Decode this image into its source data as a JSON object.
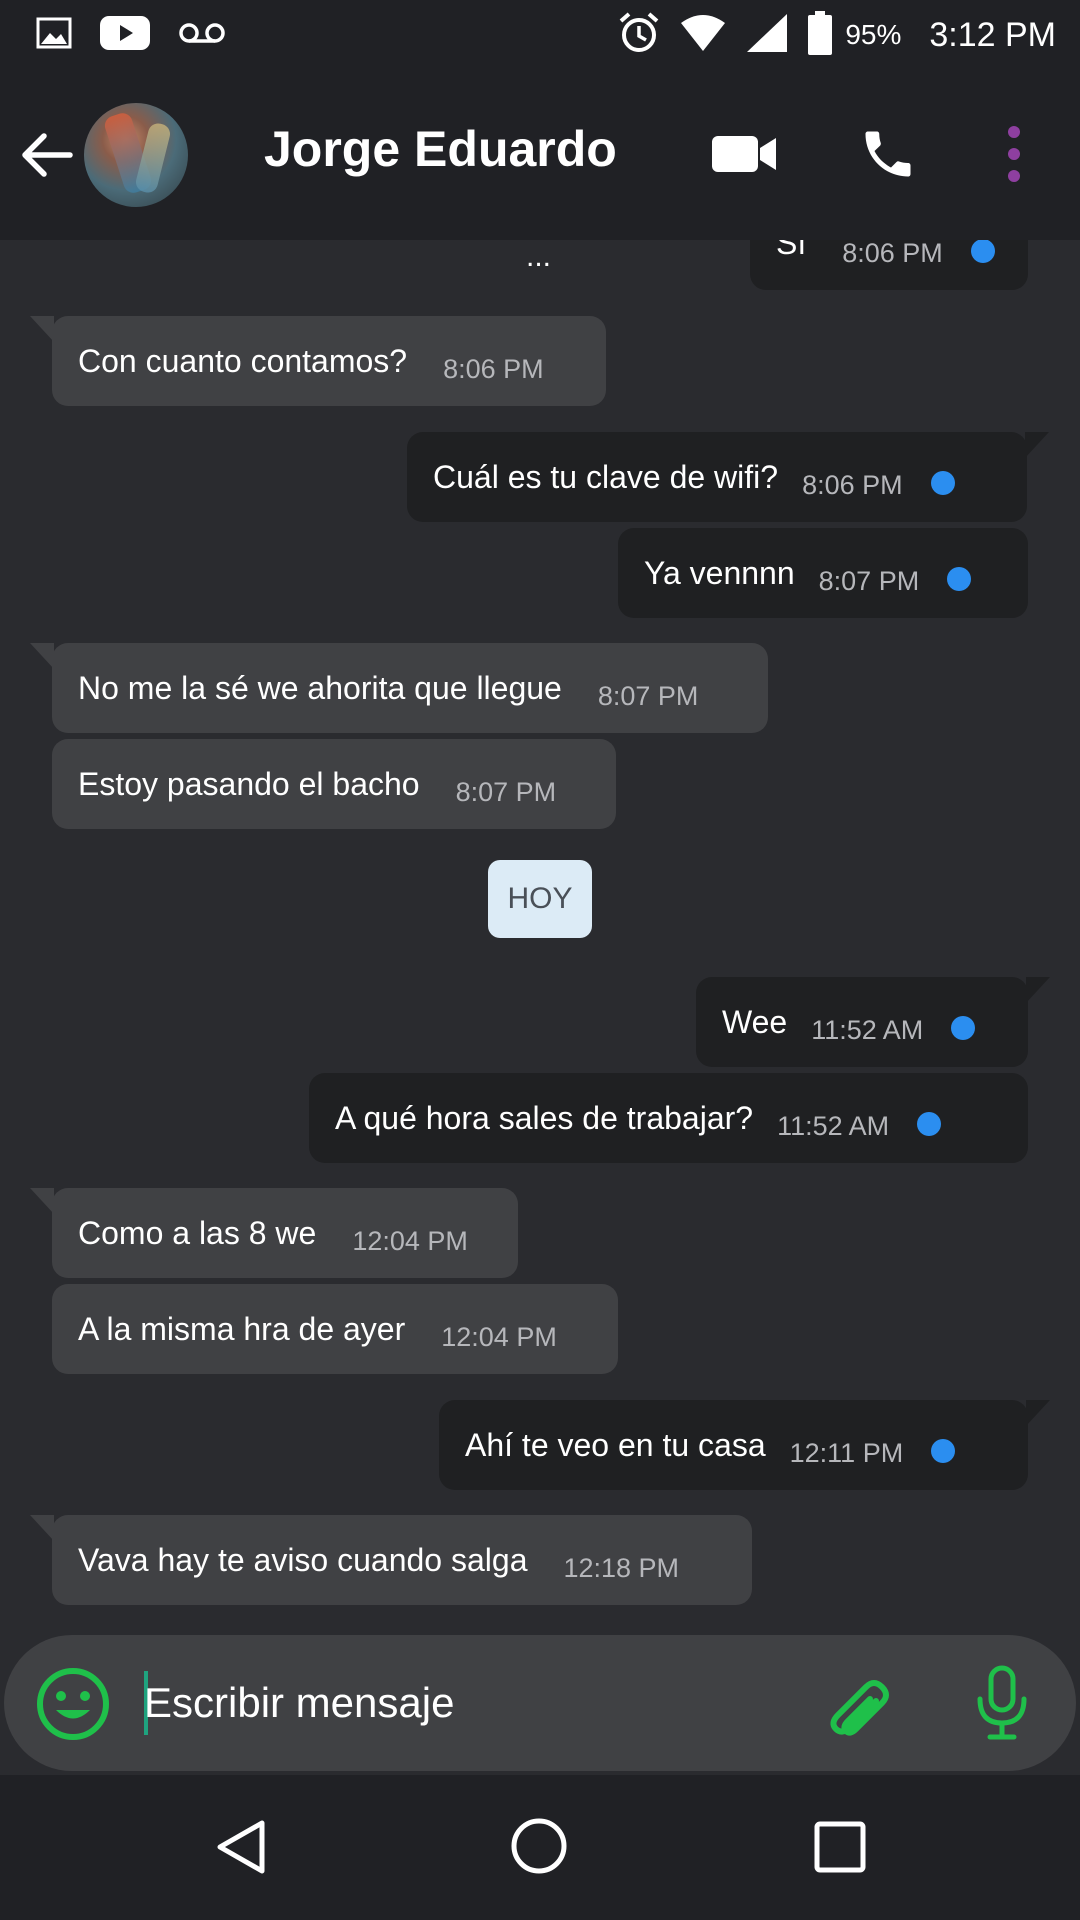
{
  "status_bar": {
    "battery": "95%",
    "time": "3:12 PM",
    "icons": [
      "image-icon",
      "youtube-icon",
      "voicemail-icon",
      "alarm-icon",
      "wifi-icon",
      "signal-icon",
      "battery-icon"
    ]
  },
  "header": {
    "contact_name": "Jorge Eduardo",
    "icons": [
      "back-arrow-icon",
      "avatar",
      "video-call-icon",
      "phone-icon",
      "more-vertical-icon"
    ],
    "accent_color": "#8e3fa0"
  },
  "chat": {
    "partial_top": {
      "text": "Sí",
      "time": "8:06 PM"
    },
    "typing_indicator": "...",
    "day_separator": "HOY",
    "messages": [
      {
        "direction": "in",
        "text": "Con cuanto contamos?",
        "time": "8:06 PM"
      },
      {
        "direction": "out",
        "text": "Cuál es tu clave de wifi?",
        "time": "8:06 PM"
      },
      {
        "direction": "out",
        "text": "Ya vennnn",
        "time": "8:07 PM"
      },
      {
        "direction": "in",
        "text": "No me la sé we ahorita que llegue",
        "time": "8:07 PM"
      },
      {
        "direction": "in",
        "text": "Estoy pasando el bacho",
        "time": "8:07 PM"
      },
      {
        "direction": "out",
        "text": "Wee",
        "time": "11:52 AM"
      },
      {
        "direction": "out",
        "text": "A qué hora sales de trabajar?",
        "time": "11:52 AM"
      },
      {
        "direction": "in",
        "text": "Como a las 8 we",
        "time": "12:04 PM"
      },
      {
        "direction": "in",
        "text": "A la misma hra de ayer",
        "time": "12:04 PM"
      },
      {
        "direction": "out",
        "text": "Ahí te veo en tu casa",
        "time": "12:11 PM"
      },
      {
        "direction": "in",
        "text": "Vava hay te aviso cuando salga",
        "time": "12:18 PM"
      }
    ],
    "read_dot_color": "#2b8ef0"
  },
  "composer": {
    "placeholder": "Escribir mensaje",
    "accent_color": "#1fc04a",
    "icons": [
      "emoji-icon",
      "attach-icon",
      "mic-icon"
    ]
  },
  "nav_bar": {
    "icons": [
      "nav-back-icon",
      "nav-home-icon",
      "nav-recent-icon"
    ]
  }
}
